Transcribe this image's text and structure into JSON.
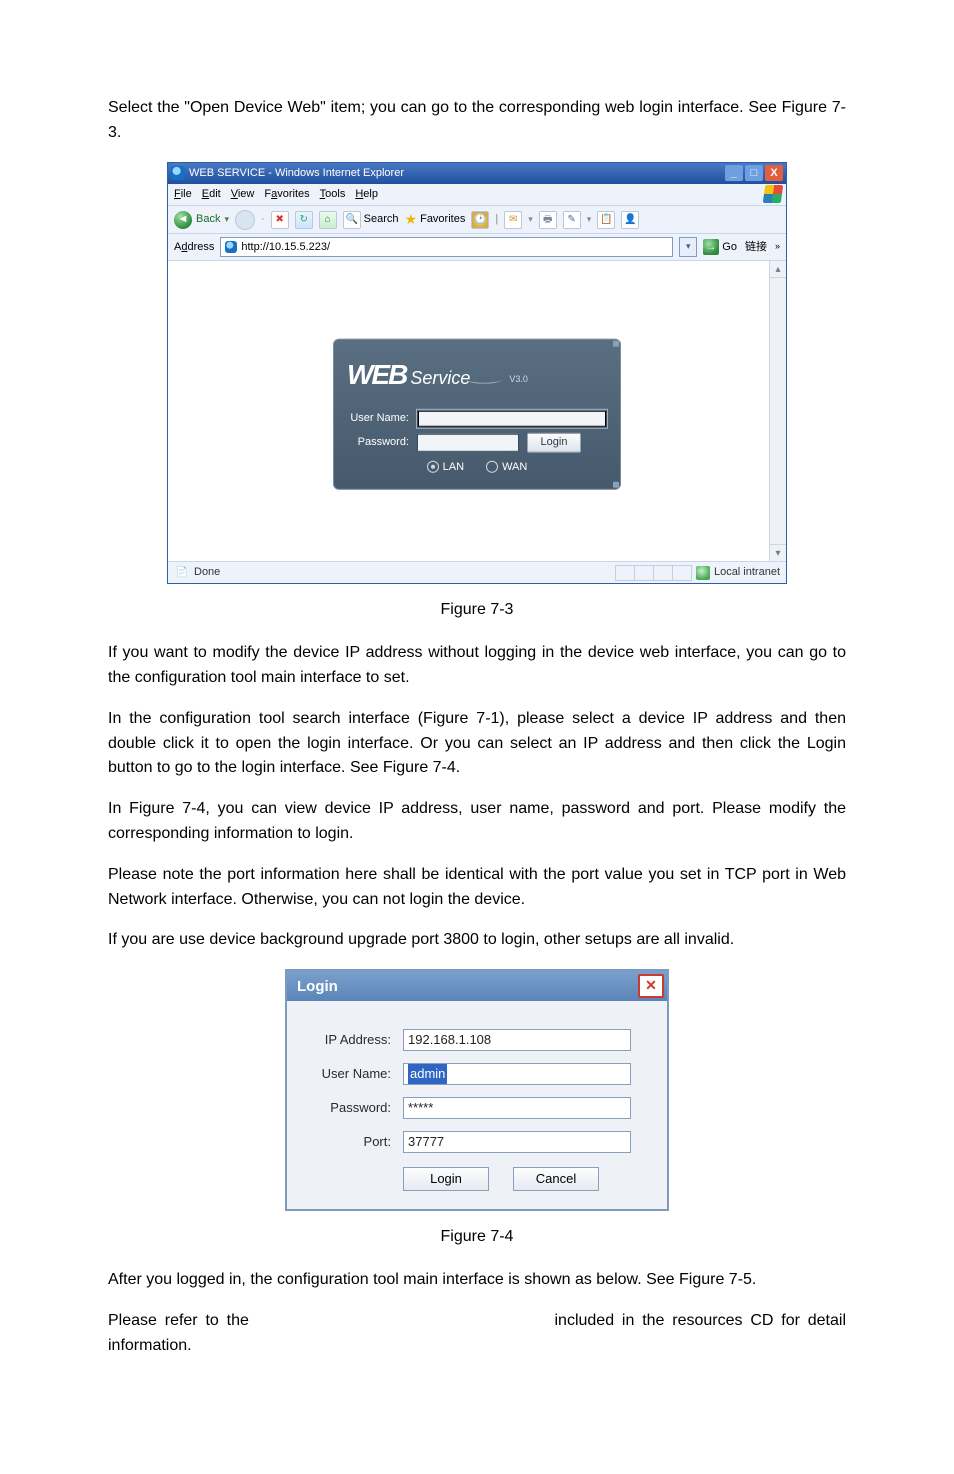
{
  "para1": "Select the \"Open Device Web\" item; you can go to the corresponding web login interface. See Figure 7-3.",
  "fig73_caption": "Figure 7-3",
  "para2": "If you want to modify the device IP address without logging in the device web interface, you can go to the configuration tool main interface to set.",
  "para3": "In the configuration tool search interface (Figure 7-1), please select a device IP address and then double click it to open the login interface. Or you can select an IP address and then click the Login button to go to the login interface. See Figure 7-4.",
  "para4": "In Figure 7-4, you can view device IP address, user name, password and port. Please modify the corresponding information to login.",
  "para5": "Please note the port information here shall be identical with the port value you set in TCP port in Web Network interface. Otherwise, you can not login the device.",
  "para6": "If you are use device background upgrade port 3800 to login, other setups are all invalid.",
  "fig74_caption": "Figure 7-4",
  "para7": "After you logged in, the configuration tool main interface is shown as below. See Figure 7-5.",
  "para8a": "Please refer to the ",
  "para8b": " included in the resources CD for detail information.",
  "ie": {
    "title": "WEB SERVICE - Windows Internet Explorer",
    "menus": {
      "file": "File",
      "edit": "Edit",
      "view": "View",
      "fav": "Favorites",
      "tools": "Tools",
      "help": "Help"
    },
    "toolbar": {
      "back": "Back",
      "search": "Search",
      "favorites": "Favorites"
    },
    "address_label": "Address",
    "url": "http://10.15.5.223/",
    "go": "Go",
    "links": "链接",
    "status_done": "Done",
    "status_zone": "Local intranet"
  },
  "webservice": {
    "brand_w": "WEB",
    "brand_srv": "Service",
    "brand_ver": "V3.0",
    "user_label": "User Name:",
    "pass_label": "Password:",
    "login_btn": "Login",
    "radio_lan": "LAN",
    "radio_wan": "WAN"
  },
  "dlg": {
    "title": "Login",
    "ip_label": "IP Address:",
    "ip_value": "192.168.1.108",
    "user_label": "User Name:",
    "user_value": "admin",
    "pass_label": "Password:",
    "pass_value": "*****",
    "port_label": "Port:",
    "port_value": "37777",
    "login_btn": "Login",
    "cancel_btn": "Cancel"
  }
}
